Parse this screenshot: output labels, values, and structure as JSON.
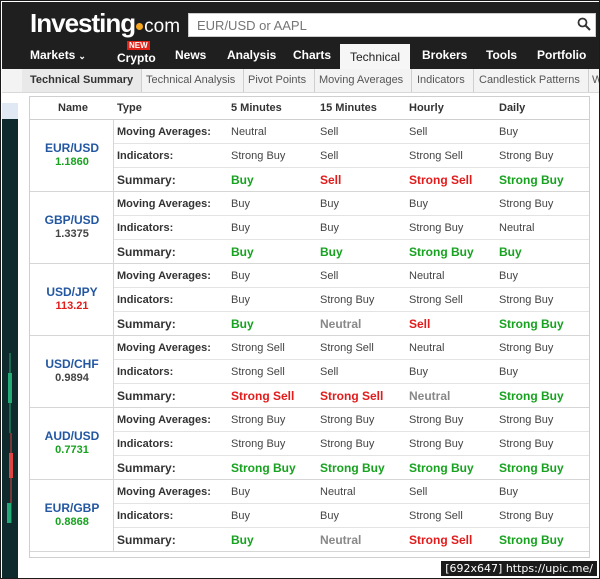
{
  "site": {
    "logo_text": "Investing",
    "logo_suffix": "com",
    "search_placeholder": "EUR/USD or AAPL"
  },
  "main_nav": [
    {
      "label": "Markets",
      "has_chevron": true
    },
    {
      "label": "Crypto",
      "badge": "NEW"
    },
    {
      "label": "News"
    },
    {
      "label": "Analysis"
    },
    {
      "label": "Charts"
    },
    {
      "label": "Technical",
      "active": true
    },
    {
      "label": "Brokers"
    },
    {
      "label": "Tools"
    },
    {
      "label": "Portfolio"
    }
  ],
  "sub_nav": [
    {
      "label": "Technical Summary",
      "active": true
    },
    {
      "label": "Technical Analysis"
    },
    {
      "label": "Pivot Points"
    },
    {
      "label": "Moving Averages"
    },
    {
      "label": "Indicators"
    },
    {
      "label": "Candlestick Patterns"
    },
    {
      "label": "W"
    }
  ],
  "table": {
    "headers": [
      "Name",
      "Type",
      "5 Minutes",
      "15 Minutes",
      "Hourly",
      "Daily"
    ],
    "row_labels": {
      "ma": "Moving Averages:",
      "ind": "Indicators:",
      "sum": "Summary:"
    },
    "groups": [
      {
        "pair": "EUR/USD",
        "price": "1.1860",
        "price_color": "#17a21f",
        "ma": [
          "Neutral",
          "Sell",
          "Sell",
          "Buy"
        ],
        "ind": [
          "Strong Buy",
          "Sell",
          "Strong Sell",
          "Strong Buy"
        ],
        "sum": [
          "Buy",
          "Sell",
          "Strong Sell",
          "Strong Buy"
        ]
      },
      {
        "pair": "GBP/USD",
        "price": "1.3375",
        "price_color": "#444444",
        "ma": [
          "Buy",
          "Buy",
          "Buy",
          "Strong Buy"
        ],
        "ind": [
          "Buy",
          "Buy",
          "Strong Buy",
          "Neutral"
        ],
        "sum": [
          "Buy",
          "Buy",
          "Strong Buy",
          "Buy"
        ]
      },
      {
        "pair": "USD/JPY",
        "price": "113.21",
        "price_color": "#e21b1b",
        "ma": [
          "Buy",
          "Sell",
          "Neutral",
          "Buy"
        ],
        "ind": [
          "Buy",
          "Strong Buy",
          "Strong Sell",
          "Strong Buy"
        ],
        "sum": [
          "Buy",
          "Neutral",
          "Sell",
          "Strong Buy"
        ]
      },
      {
        "pair": "USD/CHF",
        "price": "0.9894",
        "price_color": "#444444",
        "ma": [
          "Strong Sell",
          "Strong Sell",
          "Neutral",
          "Strong Buy"
        ],
        "ind": [
          "Strong Sell",
          "Sell",
          "Buy",
          "Buy"
        ],
        "sum": [
          "Strong Sell",
          "Strong Sell",
          "Neutral",
          "Strong Buy"
        ]
      },
      {
        "pair": "AUD/USD",
        "price": "0.7731",
        "price_color": "#17a21f",
        "ma": [
          "Strong Buy",
          "Strong Buy",
          "Strong Buy",
          "Strong Buy"
        ],
        "ind": [
          "Strong Buy",
          "Strong Buy",
          "Strong Buy",
          "Strong Buy"
        ],
        "sum": [
          "Strong Buy",
          "Strong Buy",
          "Strong Buy",
          "Strong Buy"
        ]
      },
      {
        "pair": "EUR/GBP",
        "price": "0.8868",
        "price_color": "#17a21f",
        "ma": [
          "Buy",
          "Neutral",
          "Sell",
          "Buy"
        ],
        "ind": [
          "Buy",
          "Buy",
          "Strong Sell",
          "Strong Buy"
        ],
        "sum": [
          "Buy",
          "Neutral",
          "Strong Sell",
          "Strong Buy"
        ]
      }
    ]
  },
  "watermark": "[692x647] https://upic.me/"
}
